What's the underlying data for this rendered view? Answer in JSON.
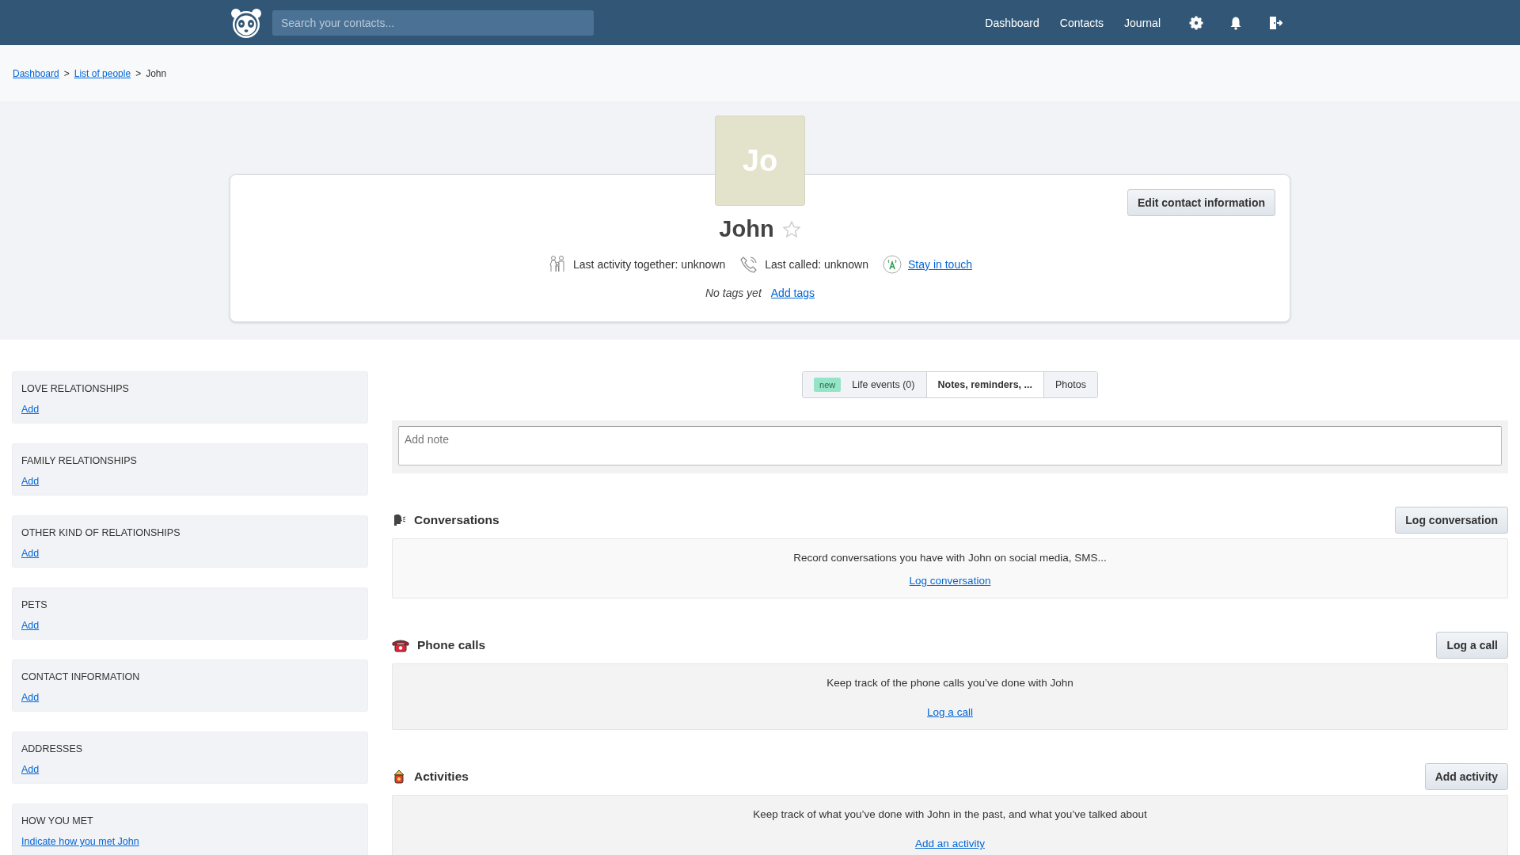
{
  "header": {
    "search": {
      "placeholder": "Search your contacts..."
    },
    "nav": [
      "Dashboard",
      "Contacts",
      "Journal"
    ]
  },
  "breadcrumb": [
    {
      "kind": "link",
      "label": "Dashboard"
    },
    {
      "kind": "separator",
      "label": ">"
    },
    {
      "kind": "link",
      "label": "List of people"
    },
    {
      "kind": "separator",
      "label": ">"
    },
    {
      "kind": "current",
      "label": "John"
    }
  ],
  "profile": {
    "initials": "Jo",
    "name": "John",
    "favorite": false,
    "edit_button": "Edit contact information",
    "last_activity": "Last activity together: unknown",
    "last_called": "Last called: unknown",
    "stay_in_touch": "Stay in touch",
    "no_tags": "No tags yet",
    "add_tags": "Add tags"
  },
  "sidebar": [
    {
      "title": "LOVE RELATIONSHIPS",
      "link": "Add"
    },
    {
      "title": "FAMILY RELATIONSHIPS",
      "link": "Add"
    },
    {
      "title": "OTHER KIND OF RELATIONSHIPS",
      "link": "Add"
    },
    {
      "title": "PETS",
      "link": "Add"
    },
    {
      "title": "CONTACT INFORMATION",
      "link": "Add"
    },
    {
      "title": "ADDRESSES",
      "link": "Add"
    },
    {
      "title": "HOW YOU MET",
      "link": "Indicate how you met John"
    }
  ],
  "tabs": [
    {
      "badge": "new",
      "label": "Life events (0)",
      "selected": false
    },
    {
      "label": "Notes, reminders, ...",
      "selected": true
    },
    {
      "label": "Photos",
      "selected": false
    }
  ],
  "note": {
    "placeholder": "Add note"
  },
  "sections": [
    {
      "kind": "conversations",
      "title": "Conversations",
      "button": "Log conversation",
      "text": "Record conversations you have with John on social media, SMS...",
      "link": "Log conversation"
    },
    {
      "kind": "calls",
      "title": "Phone calls",
      "button": "Log a call",
      "text": "Keep track of the phone calls you’ve done with John",
      "link": "Log a call"
    },
    {
      "kind": "activities",
      "title": "Activities",
      "button": "Add activity",
      "text": "Keep track of what you’ve done with John in the past, and what you’ve talked about",
      "link": "Add an activity"
    }
  ]
}
